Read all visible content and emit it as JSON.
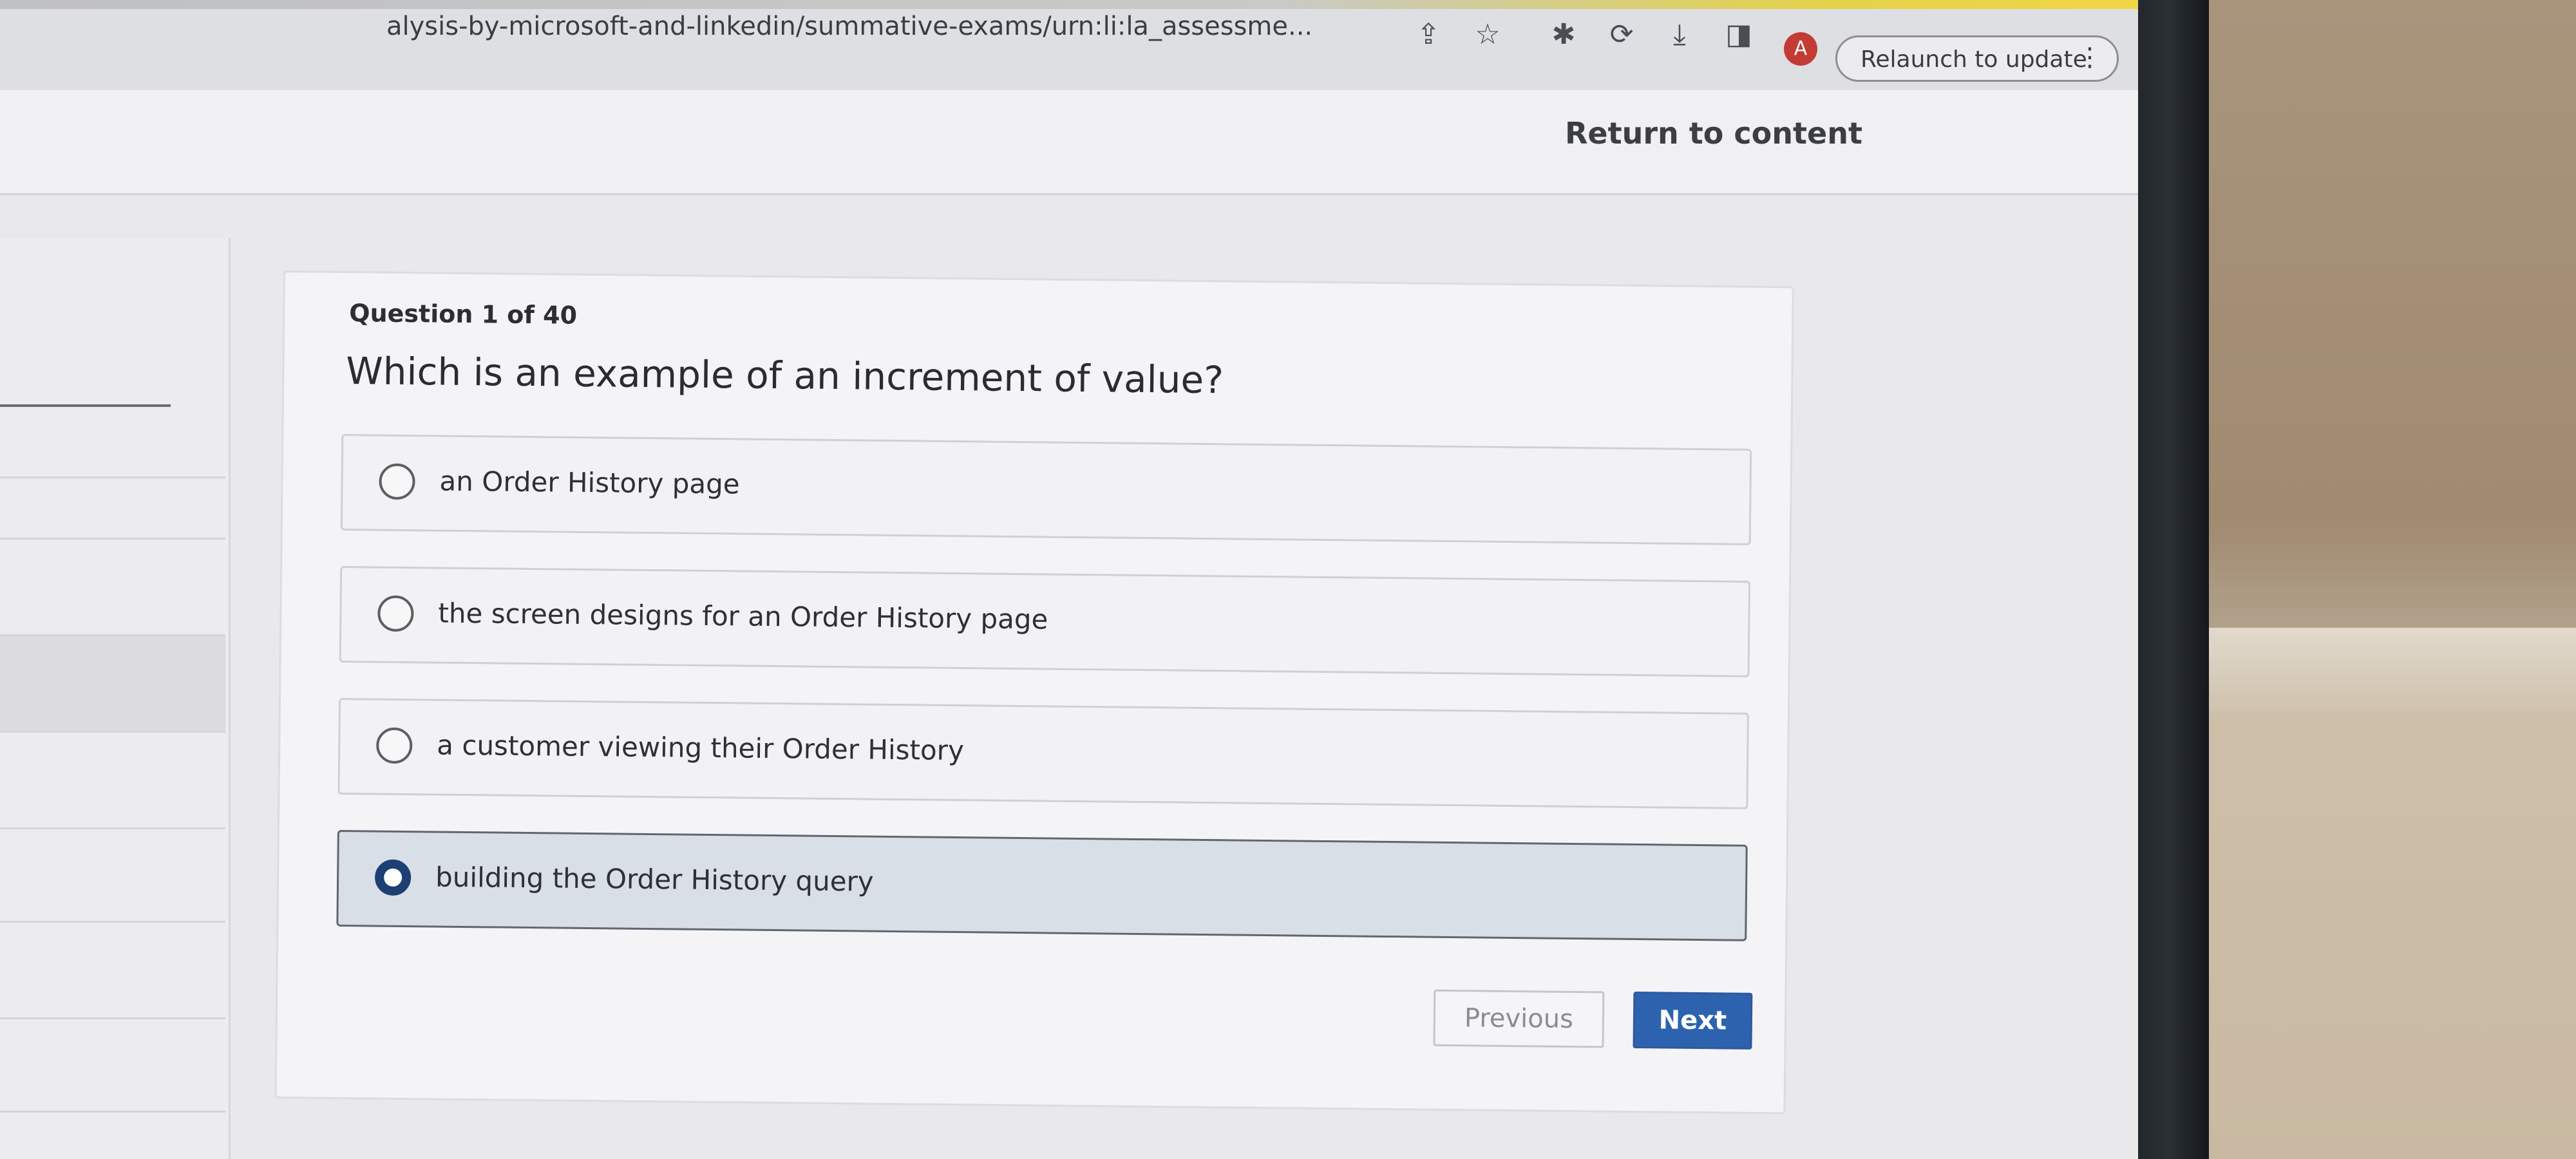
{
  "browser": {
    "url_text": "alysis-by-microsoft-and-linkedin/summative-exams/urn:li:la_assessme...",
    "avatar_letter": "A",
    "relaunch_label": "Relaunch to update",
    "icons": [
      "share-icon",
      "star-icon",
      "extensions-icon",
      "sync-icon",
      "download-icon",
      "sidepanel-icon",
      "more-menu-icon"
    ]
  },
  "header": {
    "return_link": "Return to content"
  },
  "quiz": {
    "question_counter": "Question 1 of 40",
    "question": "Which is an example of an increment of value?",
    "options": [
      {
        "label": "an Order History page",
        "selected": false
      },
      {
        "label": "the screen designs for an Order History page",
        "selected": false
      },
      {
        "label": "a customer viewing their Order History",
        "selected": false
      },
      {
        "label": "building the Order History query",
        "selected": true
      }
    ],
    "previous_label": "Previous",
    "next_label": "Next"
  },
  "colors": {
    "accent": "#2d63ae",
    "selected_option_bg": "#d9dfe6",
    "avatar": "#c43b35"
  }
}
